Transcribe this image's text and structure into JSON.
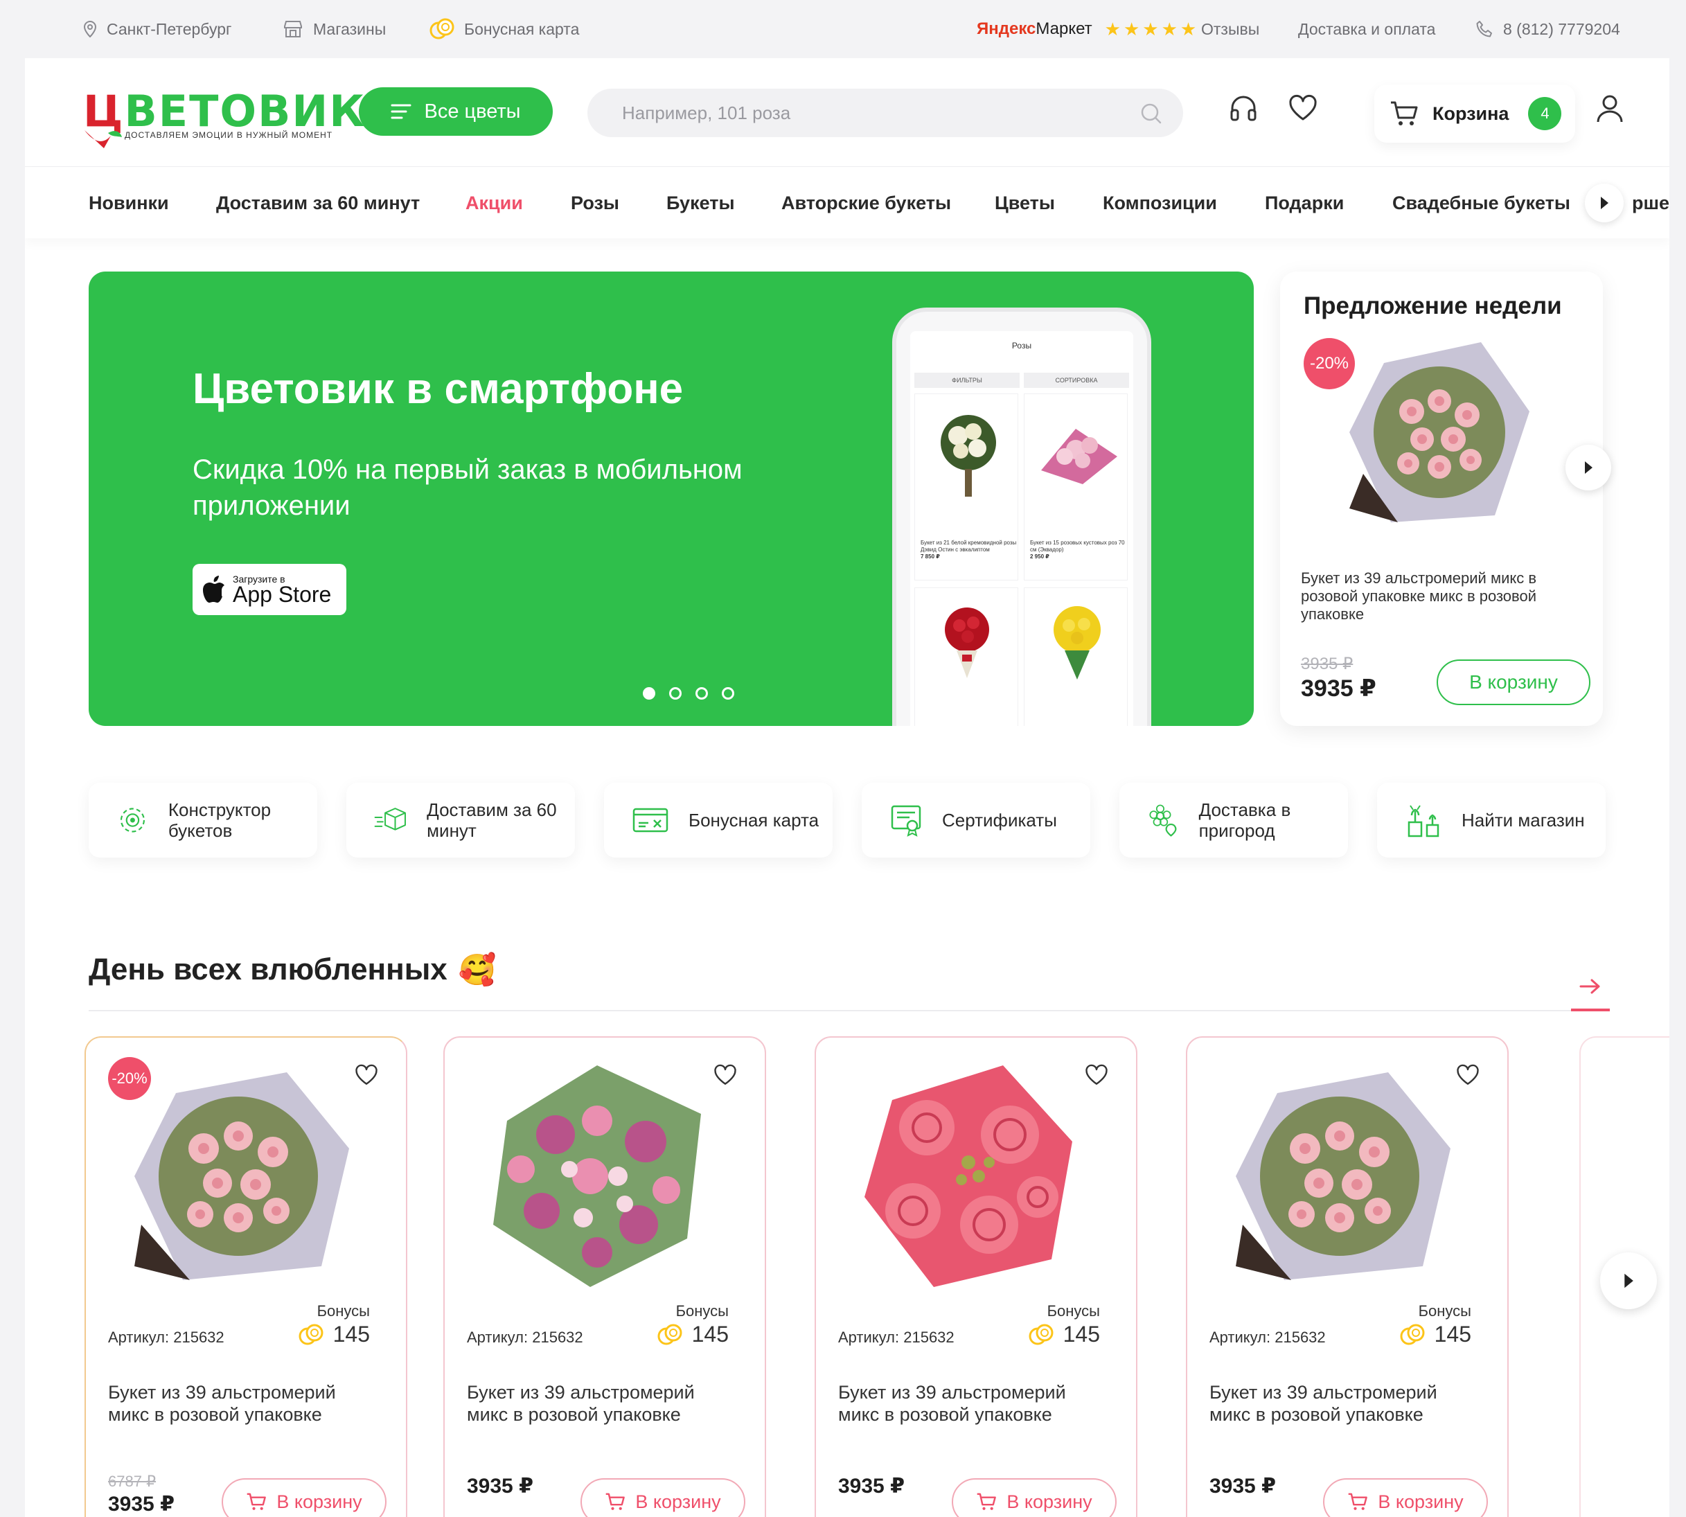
{
  "topbar": {
    "city": "Санкт-Петербург",
    "stores": "Магазины",
    "bonus_card": "Бонусная карта",
    "yandex_brand": "Яндекс",
    "yandex_market": "Маркет",
    "rating_stars": 5,
    "reviews": "Отзывы",
    "delivery": "Доставка и оплата",
    "phone": "8 (812) 7779204"
  },
  "header": {
    "logo_text_first": "Ц",
    "logo_text_rest": "ВЕТОВИК",
    "logo_tagline": "Доставляем эмоции в нужный момент",
    "catalog_button": "Все цветы",
    "search_placeholder": "Например, 101 роза",
    "cart_label": "Корзина",
    "cart_count": "4"
  },
  "nav": {
    "items": [
      {
        "label": "Новинки"
      },
      {
        "label": "Доставим за 60 минут"
      },
      {
        "label": "Акции"
      },
      {
        "label": "Розы"
      },
      {
        "label": "Букеты"
      },
      {
        "label": "Авторские букеты"
      },
      {
        "label": "Цветы"
      },
      {
        "label": "Композиции"
      },
      {
        "label": "Подарки"
      },
      {
        "label": "Свадебные букеты"
      },
      {
        "label": "рше"
      }
    ],
    "active_index": 2
  },
  "hero": {
    "title": "Цветовик в смартфоне",
    "subtitle": "Скидка 10% на первый заказ в мобильном приложении",
    "appstore_small": "Загрузите в",
    "appstore_big": "App Store",
    "slides": 4,
    "active_slide": 1,
    "phone": {
      "header": "Розы",
      "tab1": "ФИЛЬТРЫ",
      "tab2": "СОРТИРОВКА",
      "card1": "Букет из 21 белой кремовидной розы Дэвид Остин с эвкалиптом",
      "card1_price": "7 850 ₽",
      "card2": "Букет из 15 розовых кустовых роз 70 см (Эквадор)",
      "card2_price": "2 950 ₽"
    }
  },
  "offer": {
    "title": "Предложение недели",
    "badge": "-20%",
    "name": "Букет из 39 альстромерий микс в розовой упаковке микс в розовой упаковке",
    "old_price": "3935 ₽",
    "price": "3935 ₽",
    "button": "В корзину"
  },
  "features": [
    {
      "label": "Конструктор букетов",
      "icon": "gear-icon"
    },
    {
      "label": "Доставим за 60 минут",
      "icon": "delivery-box-icon"
    },
    {
      "label": "Бонусная карта",
      "icon": "card-icon"
    },
    {
      "label": "Сертификаты",
      "icon": "certificate-icon"
    },
    {
      "label": "Доставка в пригород",
      "icon": "flower-location-icon"
    },
    {
      "label": "Найти магазин",
      "icon": "store-plants-icon"
    }
  ],
  "section": {
    "title": "День всех влюбленных",
    "emoji": "🥰"
  },
  "products": [
    {
      "badge": "-20%",
      "bonus_label": "Бонусы",
      "bonus": "145",
      "article": "Артикул: 215632",
      "name": "Букет из 39 альстромерий микс в розовой упаковке",
      "old_price": "6787 ₽",
      "price": "3935 ₽",
      "button": "В корзину"
    },
    {
      "badge": "",
      "bonus_label": "Бонусы",
      "bonus": "145",
      "article": "Артикул: 215632",
      "name": "Букет из 39 альстромерий микс в розовой упаковке",
      "old_price": "",
      "price": "3935 ₽",
      "button": "В корзину"
    },
    {
      "badge": "",
      "bonus_label": "Бонусы",
      "bonus": "145",
      "article": "Артикул: 215632",
      "name": "Букет из 39 альстромерий микс в розовой упаковке",
      "old_price": "",
      "price": "3935 ₽",
      "button": "В корзину"
    },
    {
      "badge": "",
      "bonus_label": "Бонусы",
      "bonus": "145",
      "article": "Артикул: 215632",
      "name": "Букет из 39 альстромерий микс в розовой упаковке",
      "old_price": "",
      "price": "3935 ₽",
      "button": "В корзину"
    }
  ],
  "colors": {
    "brand_green": "#2fbf4b",
    "accent_pink": "#ef4f6a",
    "logo_red": "#d9232d",
    "star_yellow": "#fcc419"
  }
}
